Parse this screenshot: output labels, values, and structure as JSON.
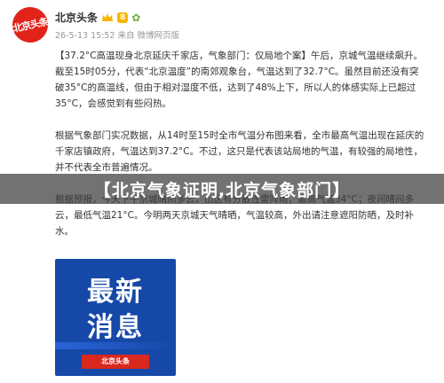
{
  "header": {
    "avatar_text": "北京头条",
    "username": "北京头条",
    "badge": "8",
    "meta": "26-5-13 15:52 来自 微博网页版"
  },
  "post": {
    "p1": "【37.2°C高温现身北京延庆千家店，气象部门：仅局地个案】午后，京城气温继续飙升。截至15时05分，代表“北京温度”的南郊观象台，气温达到了32.7°C。虽然目前还没有突破35°C的高温线，但由于相对湿度不低，达到了48%上下，所以人的体感实际上已超过35°C，会感觉到有些闷热。",
    "p2": "根据气象部门实况数据，从14时至15时全市气温分布图来看，全市最高气温出现在延庆的千家店镇政府，气温达到37.2°C。不过，这只是代表该站局地的气温，有较强的局地性，并不代表全市普遍情况。",
    "p3": "根据预报，今天下午京城晴间多云，山区有分散性雷阵雨，最高气温34°C；夜间晴间多云，最低气温21°C。今明两天京城天气晴晒，气温较高，外出请注意遮阳防晒，及时补水。"
  },
  "banner": {
    "text": "【北京气象证明,北京气象部门】"
  },
  "image": {
    "line1": "最新",
    "line2": "消息",
    "logo": "北京头条"
  },
  "colors": {
    "accent": "#eb7350",
    "brand": "#e2231a",
    "image_bg": "#1648a8"
  }
}
